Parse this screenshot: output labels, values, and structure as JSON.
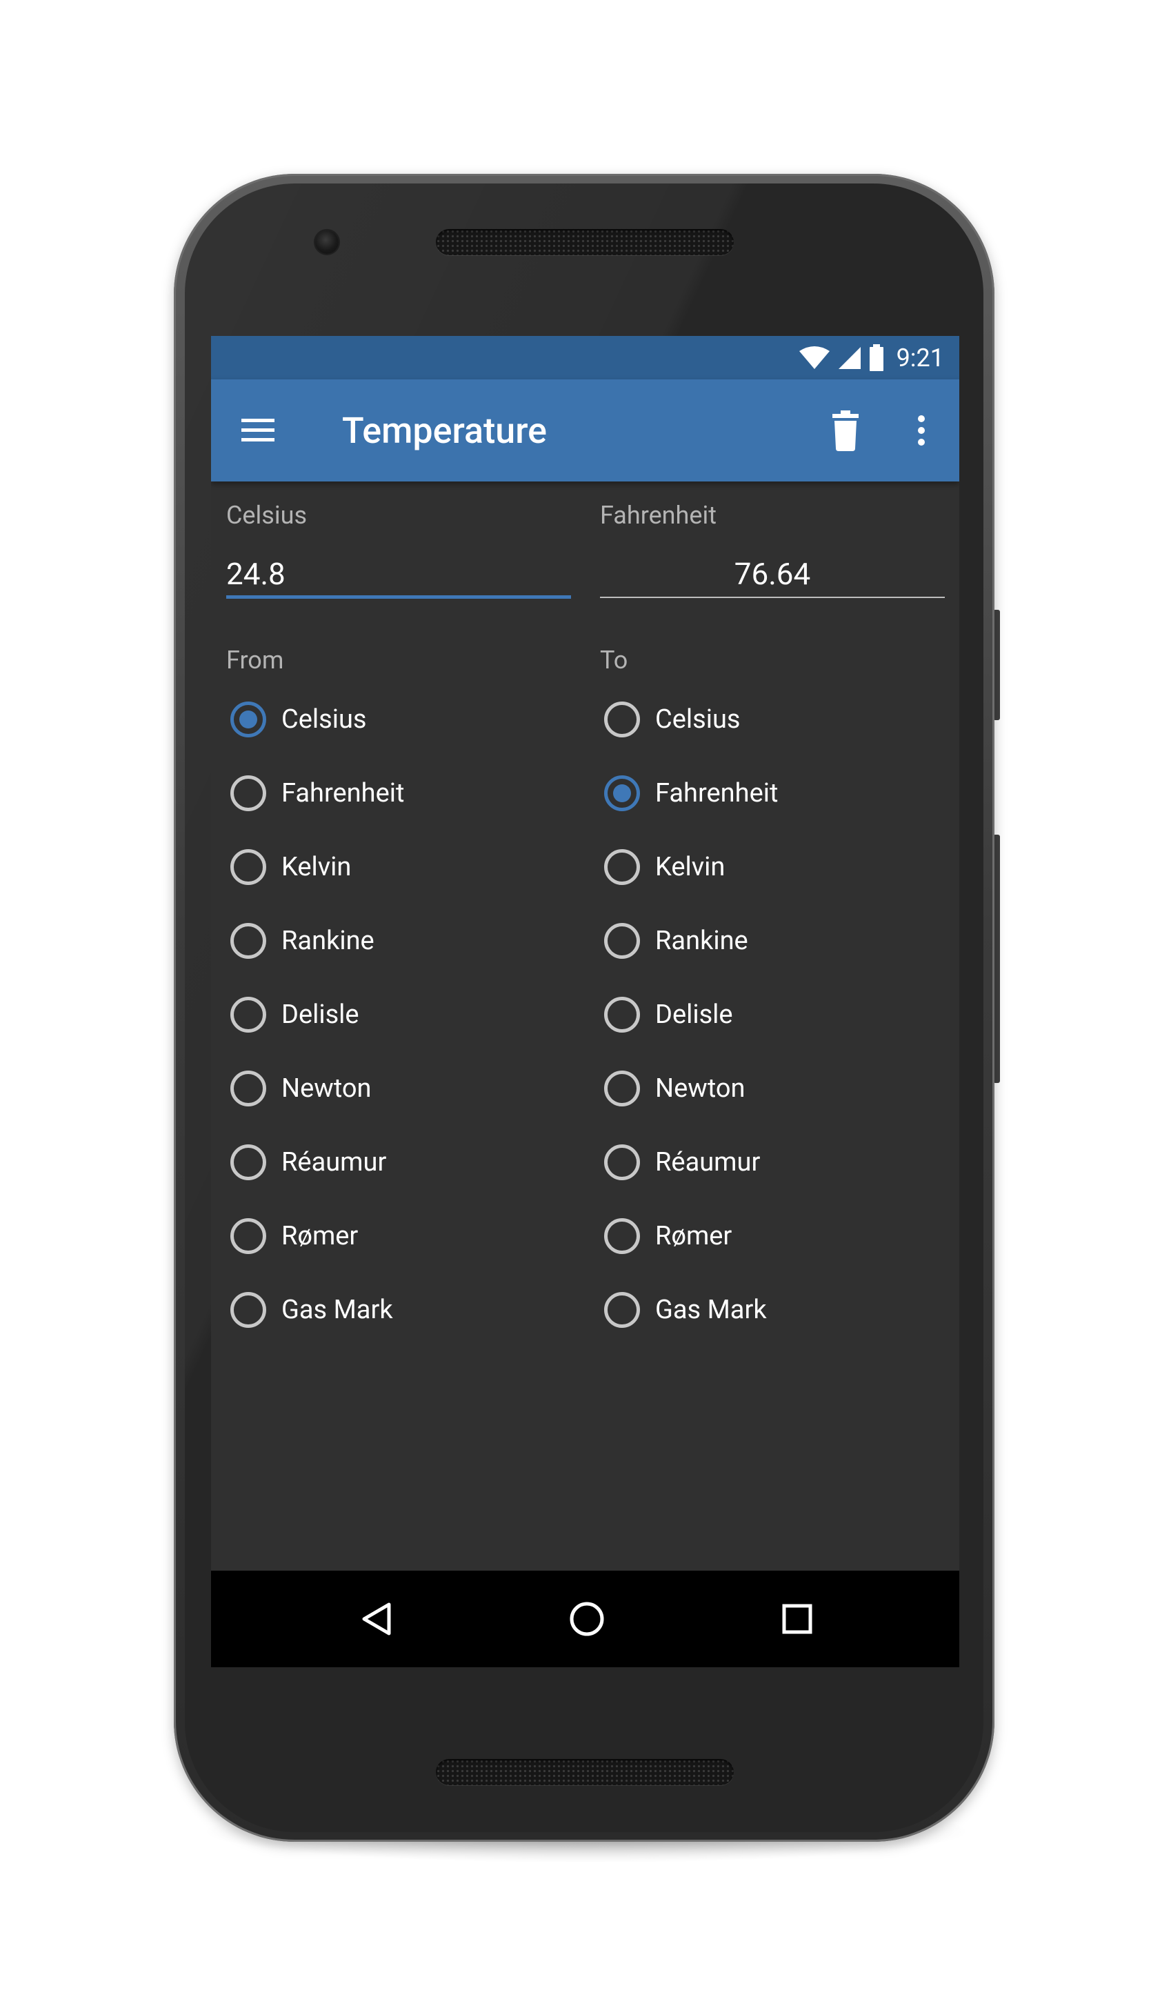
{
  "status_bar": {
    "time": "9:21"
  },
  "app_bar": {
    "title": "Temperature"
  },
  "from_field": {
    "label": "Celsius",
    "value": "24.8"
  },
  "to_field": {
    "label": "Fahrenheit",
    "value": "76.64"
  },
  "from_group": {
    "label": "From",
    "options": [
      "Celsius",
      "Fahrenheit",
      "Kelvin",
      "Rankine",
      "Delisle",
      "Newton",
      "Réaumur",
      "Rømer",
      "Gas Mark"
    ],
    "selected": "Celsius"
  },
  "to_group": {
    "label": "To",
    "options": [
      "Celsius",
      "Fahrenheit",
      "Kelvin",
      "Rankine",
      "Delisle",
      "Newton",
      "Réaumur",
      "Rømer",
      "Gas Mark"
    ],
    "selected": "Fahrenheit"
  },
  "colors": {
    "primary": "#3c73ad",
    "primary_dark": "#2e5f91",
    "accent": "#3f78b7",
    "background": "#303030"
  },
  "icons": {
    "menu": "menu-icon",
    "delete": "trash-icon",
    "overflow": "more-vert-icon",
    "swap": "swap-icon",
    "back": "back-icon",
    "home": "home-icon",
    "recents": "recents-icon"
  }
}
